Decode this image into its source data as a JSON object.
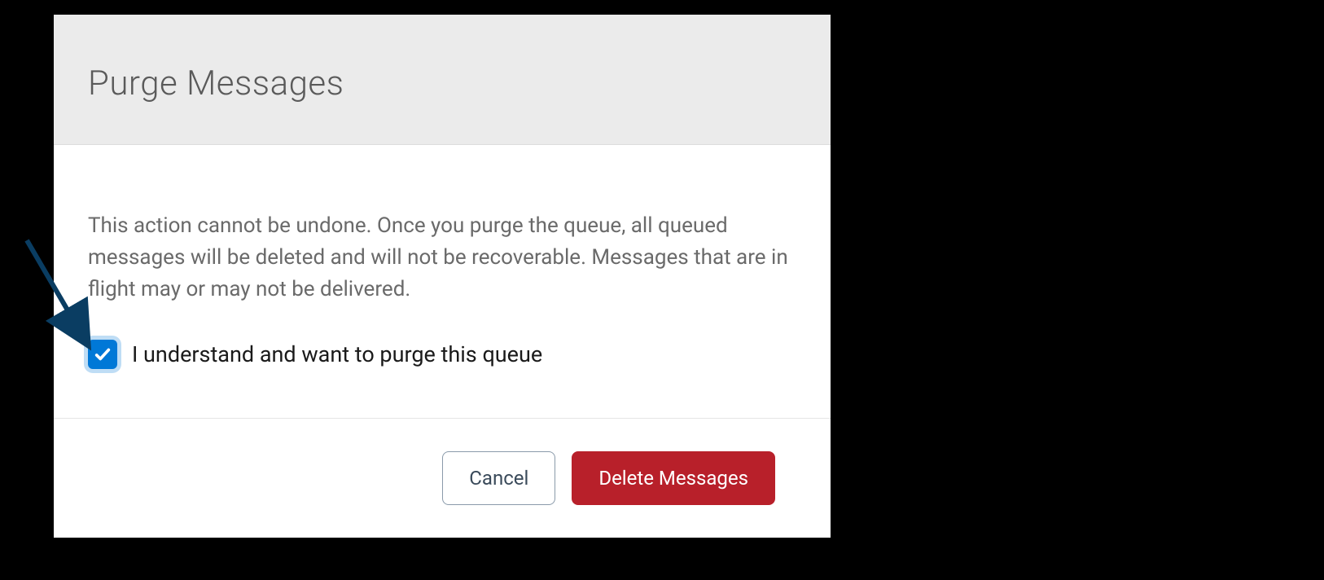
{
  "modal": {
    "title": "Purge Messages",
    "warning": "This action cannot be undone. Once you purge the queue, all queued messages will be deleted and will not be recoverable. Messages that are in flight may or may not be delivered.",
    "checkbox": {
      "checked": true,
      "label": "I understand and want to purge this queue"
    },
    "buttons": {
      "cancel": "Cancel",
      "confirm": "Delete Messages"
    }
  },
  "colors": {
    "checkbox_accent": "#0078d7",
    "danger": "#b8202a"
  }
}
